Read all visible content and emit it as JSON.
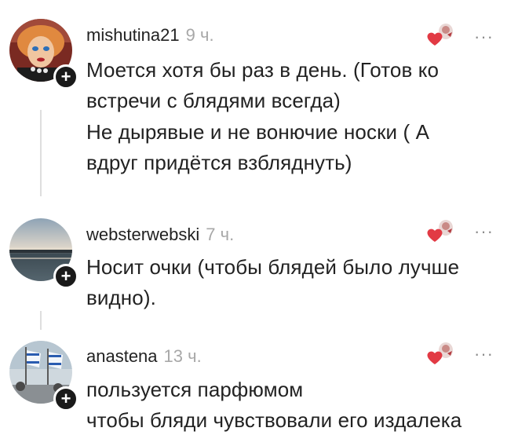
{
  "comments": [
    {
      "username": "mishutina21",
      "time": "9 ч.",
      "lines": [
        "Моется хотя бы раз в день. (Готов ко",
        "встречи с блядями всегда)",
        "Не дырявые и не вонючие носки ( А",
        "вдруг придётся взбляднуть)"
      ],
      "more_label": "···",
      "follow_badge": "+"
    },
    {
      "username": "websterwebski",
      "time": "7 ч.",
      "lines": [
        "Носит очки (чтобы блядей было лучше",
        "видно)."
      ],
      "more_label": "···",
      "follow_badge": "+"
    },
    {
      "username": "anastena",
      "time": "13 ч.",
      "lines": [
        "пользуется парфюмом",
        "чтобы бляди чувствовали его издалека"
      ],
      "more_label": "···",
      "follow_badge": "+"
    }
  ],
  "icons": {
    "reaction": "heart-reaction-icon",
    "more": "more-dots-icon",
    "follow": "plus-icon"
  },
  "colors": {
    "heart": "#e23a44",
    "username": "#222222",
    "timestamp": "#a8a8a8",
    "thread_line": "#dedede"
  }
}
